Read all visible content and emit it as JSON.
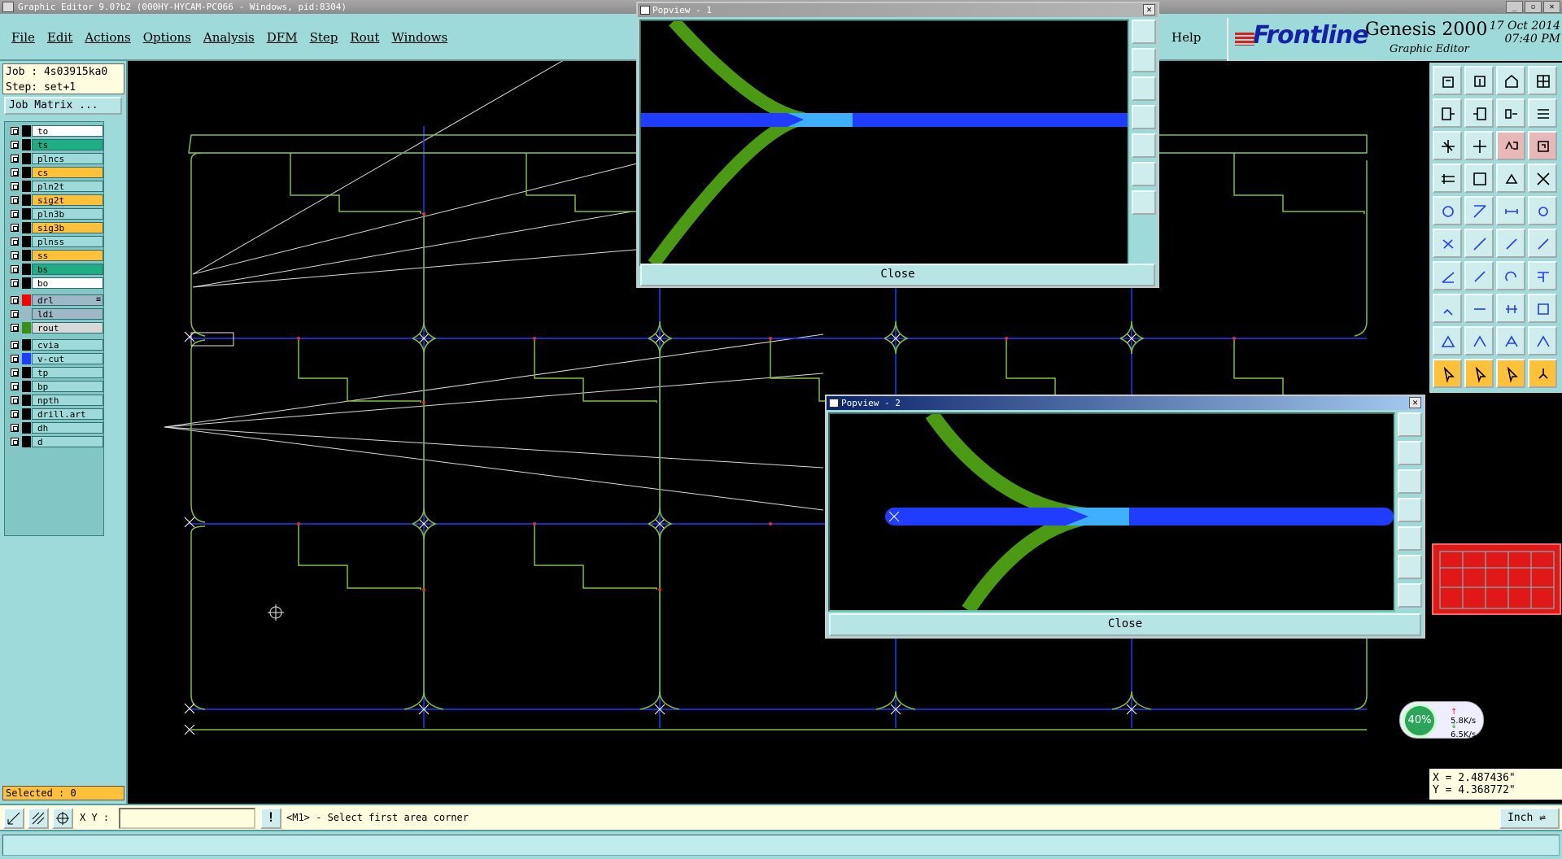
{
  "window": {
    "title": "Graphic Editor 9.0?b2 (000HY-HYCAM-PC066 - Windows, pid:8304)"
  },
  "menu": {
    "items": [
      "File",
      "Edit",
      "Actions",
      "Options",
      "Analysis",
      "DFM",
      "Step",
      "Rout",
      "Windows"
    ],
    "help": "Help"
  },
  "brand": {
    "logo": "Frontline",
    "product": "Genesis 2000",
    "subtitle": "Graphic Editor",
    "date": "17 Oct 2014",
    "time": "07:40 PM"
  },
  "job": {
    "job_line": "Job : 4s03915ka0",
    "step_line": "Step: set+1",
    "matrix_button": "Job Matrix ..."
  },
  "layers": [
    {
      "name": "to",
      "color": "#ffffff"
    },
    {
      "name": "ts",
      "color": "#1fae83"
    },
    {
      "name": "plncs",
      "color": "#9fdada"
    },
    {
      "name": "cs",
      "color": "#ffc03a"
    },
    {
      "name": "pln2t",
      "color": "#9fdada"
    },
    {
      "name": "sig2t",
      "color": "#ffc03a"
    },
    {
      "name": "pln3b",
      "color": "#9fdada"
    },
    {
      "name": "sig3b",
      "color": "#ffc03a"
    },
    {
      "name": "plnss",
      "color": "#9fdada"
    },
    {
      "name": "ss",
      "color": "#ffc03a"
    },
    {
      "name": "bs",
      "color": "#1fae83"
    },
    {
      "name": "bo",
      "color": "#ffffff"
    },
    {
      "name": "drl",
      "color": "#9fb8c8",
      "swatch": "#ff0000",
      "star": "≡"
    },
    {
      "name": "ldi",
      "color": "#9fb8c8",
      "swatch": "#9fb8c8"
    },
    {
      "name": "rout",
      "color": "#d8d8d8",
      "swatch": "#3a8f1a"
    },
    {
      "name": "cvia",
      "color": "#9fdada"
    },
    {
      "name": "v-cut",
      "color": "#9fdada",
      "swatch": "#1f3cff"
    },
    {
      "name": "tp",
      "color": "#9fdada"
    },
    {
      "name": "bp",
      "color": "#9fdada"
    },
    {
      "name": "npth",
      "color": "#9fdada"
    },
    {
      "name": "drill.art",
      "color": "#9fdada"
    },
    {
      "name": "dh",
      "color": "#9fdada"
    },
    {
      "name": "d",
      "color": "#9fdada"
    }
  ],
  "selected": "Selected : 0",
  "coords": {
    "x": "X = 2.487436\"",
    "y": "Y = 4.368772\""
  },
  "netmon": {
    "percent": "40%",
    "up": "5.8K/s",
    "down": "6.5K/s"
  },
  "bottom": {
    "xy_label": "X Y :",
    "xy_value": "",
    "prompt": "<M1> - Select first area corner",
    "unit": "Inch"
  },
  "popups": [
    {
      "title": "Popview - 1",
      "close": "Close"
    },
    {
      "title": "Popview - 2",
      "close": "Close"
    }
  ],
  "colors": {
    "rout": "#5ea02a",
    "vcut": "#1f3cff",
    "outline": "#7fbf3f",
    "highlight": "#3fb0ff",
    "drill": "#e03030"
  }
}
